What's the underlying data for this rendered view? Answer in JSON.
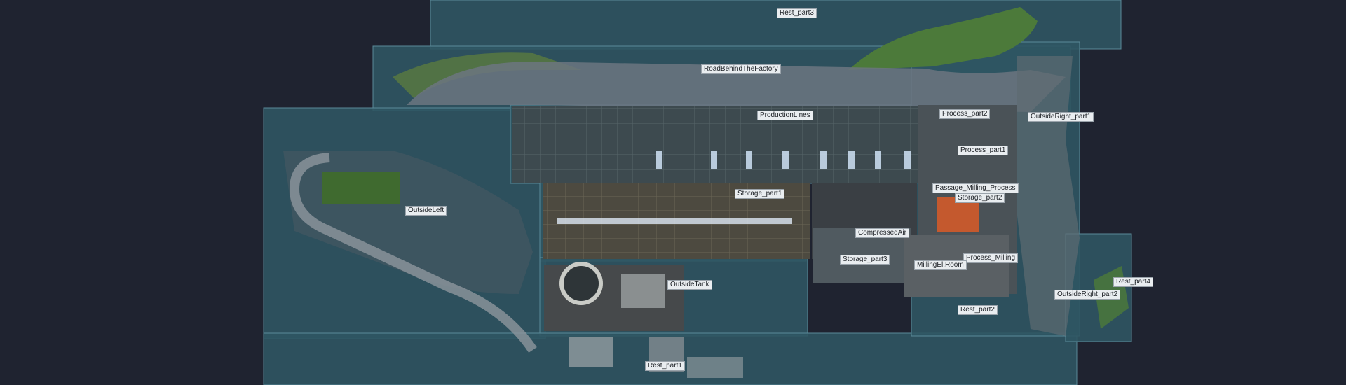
{
  "colors": {
    "background": "#1f2330",
    "bbox_fill": "#2f5563",
    "bbox_stroke": "#5a8a99",
    "label_bg": "#e9edf0",
    "label_text": "#1b1f24",
    "hotspot_orange": "#d25a2a"
  },
  "labels": {
    "rest_part3": "Rest_part3",
    "road_behind": "RoadBehindTheFactory",
    "production_lines": "ProductionLines",
    "process_part2": "Process_part2",
    "outside_right_part1": "OutsideRight_part1",
    "process_part1": "Process_part1",
    "passage_milling_process": "Passage_Milling_Process",
    "storage_part2": "Storage_part2",
    "storage_part1": "Storage_part1",
    "outside_left": "OutsideLeft",
    "compressed_air": "CompressedAir",
    "storage_part3": "Storage_part3",
    "process_milling": "Process_Milling",
    "milling_el_room": "MillingEl.Room",
    "outside_tank": "OutsideTank",
    "rest_part4": "Rest_part4",
    "outside_right_part2": "OutsideRight_part2",
    "rest_part2": "Rest_part2",
    "rest_part1": "Rest_part1"
  }
}
